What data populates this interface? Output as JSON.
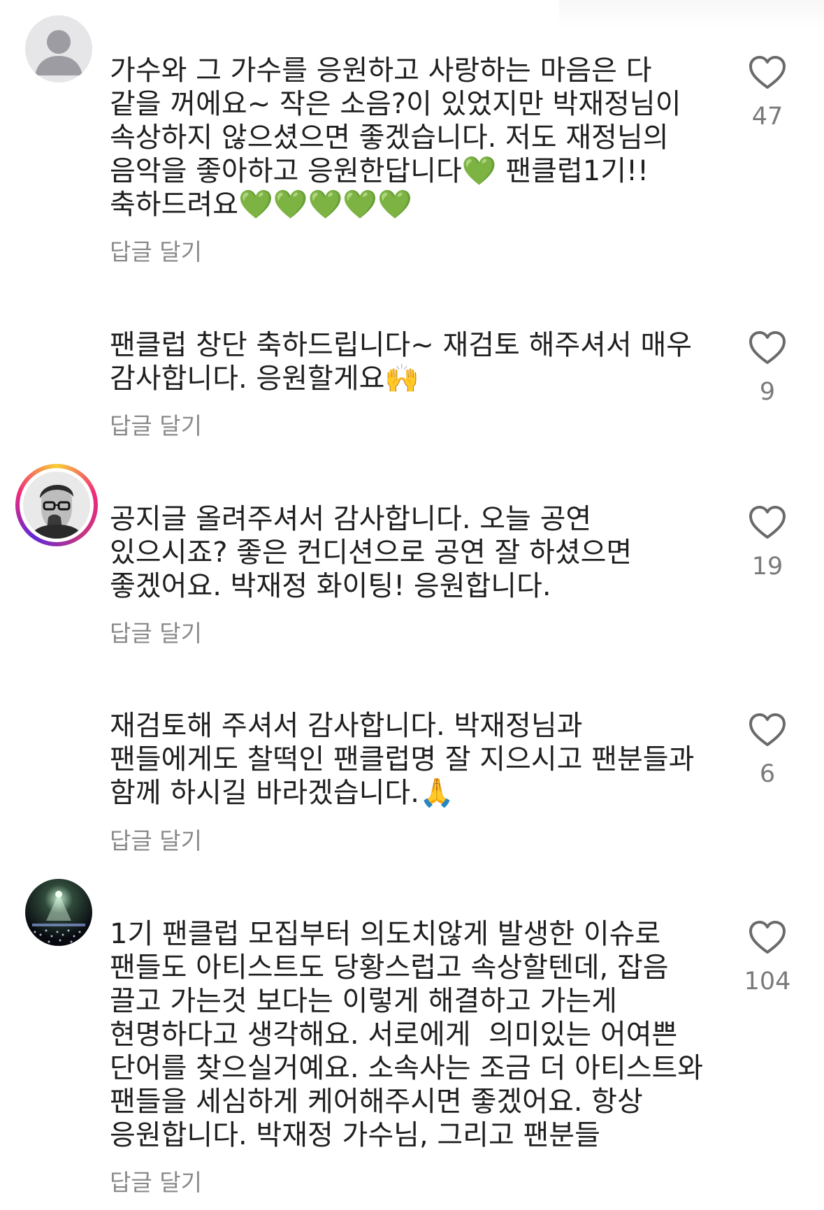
{
  "reply_label": "답글 달기",
  "icons": {
    "like": "heart-outline-icon",
    "default_avatar": "person-placeholder-icon"
  },
  "colors": {
    "text": "#1f1f1f",
    "secondary": "#8a8a8a",
    "count": "#7a7a7a"
  },
  "comments": [
    {
      "text": "가수와 그 가수를 응원하고 사랑하는 마음은 다 같을 꺼에요~ 작은 소음?이 있었지만 박재정님이 속상하지 않으셨으면 좋겠습니다. 저도 재정님의 음악을 좋아하고 응원한답니다💚 팬클럽1기!!축하드려요💚💚💚💚💚",
      "reply": "답글 달기",
      "likes": "47",
      "avatar": "default"
    },
    {
      "text": "팬클럽 창단 축하드립니다~ 재검토 해주셔서 매우 감사합니다. 응원할게요🙌",
      "reply": "답글 달기",
      "likes": "9",
      "avatar": "none"
    },
    {
      "text": "공지글 올려주셔서 감사합니다. 오늘 공연 있으시죠? 좋은 컨디션으로 공연 잘 하셨으면 좋겠어요. 박재정 화이팅! 응원합니다.",
      "reply": "답글 달기",
      "likes": "19",
      "avatar": "story"
    },
    {
      "text": "재검토해 주셔서 감사합니다. 박재정님과 팬들에게도 찰떡인 팬클럽명 잘 지으시고 팬분들과 함께 하시길 바라겠습니다.🙏",
      "reply": "답글 달기",
      "likes": "6",
      "avatar": "none"
    },
    {
      "text": "1기 팬클럽 모집부터 의도치않게 발생한 이슈로 팬들도 아티스트도 당황스럽고 속상할텐데, 잡음 끌고 가는것 보다는 이렇게 해결하고 가는게 현명하다고 생각해요. 서로에게  의미있는 어여쁜 단어를 찾으실거예요. 소속사는 조금 더 아티스트와 팬들을 세심하게 케어해주시면 좋겠어요. 항상 응원합니다. 박재정 가수님, 그리고 팬분들",
      "reply": "답글 달기",
      "likes": "104",
      "avatar": "concert"
    }
  ]
}
